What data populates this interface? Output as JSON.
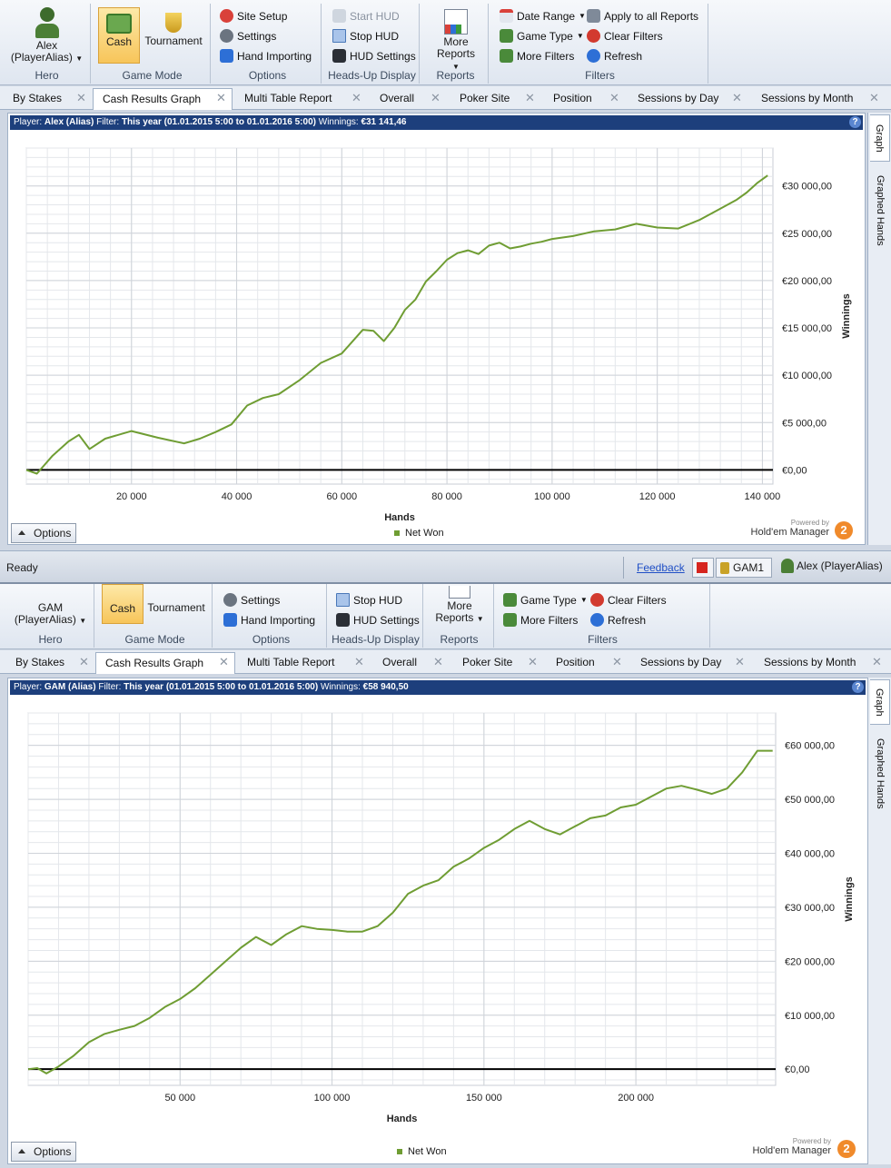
{
  "colors": {
    "series": "#6f9d33",
    "header_bg": "#1d3f7c",
    "active_button": "#f7c55a"
  },
  "panels": [
    {
      "ribbon": {
        "hero": {
          "name": "Alex",
          "alias": "(PlayerAlias)",
          "title": "Hero"
        },
        "game_mode": {
          "cash": "Cash",
          "tournament": "Tournament",
          "title": "Game Mode"
        },
        "options": {
          "site_setup": "Site Setup",
          "settings": "Settings",
          "hand_importing": "Hand Importing",
          "title": "Options"
        },
        "hud": {
          "start": "Start HUD",
          "stop": "Stop HUD",
          "settings": "HUD Settings",
          "title": "Heads-Up Display"
        },
        "reports": {
          "more1": "More",
          "more2": "Reports",
          "title": "Reports"
        },
        "filters": {
          "date_range": "Date Range",
          "apply_all": "Apply to all Reports",
          "game_type": "Game Type",
          "clear": "Clear Filters",
          "more": "More Filters",
          "refresh": "Refresh",
          "title": "Filters"
        }
      },
      "tabs": [
        "By Stakes",
        "Cash Results Graph",
        "Multi Table Report",
        "Overall",
        "Poker Site",
        "Position",
        "Sessions by Day",
        "Sessions by Month"
      ],
      "header": {
        "player_label": "Player:",
        "player": "Alex (Alias)",
        "filter_label": "Filter:",
        "filter": "This year (01.01.2015 5:00 to 01.01.2016 5:00)",
        "winnings_label": "Winnings:",
        "winnings": "€31 141,46",
        "help": "?"
      },
      "side_tabs": [
        "Graph",
        "Graphed Hands"
      ],
      "options_label": "Options",
      "powered_by": "Powered by",
      "brand": "Hold'em Manager",
      "brand_logo": "2",
      "status": {
        "ready": "Ready",
        "feedback": "Feedback",
        "site": "GAM1",
        "user": "Alex (PlayerAlias)"
      }
    },
    {
      "ribbon": {
        "hero": {
          "name": "GAM",
          "alias": "(PlayerAlias)",
          "title": "Hero"
        },
        "game_mode": {
          "cash": "Cash",
          "tournament": "Tournament",
          "title": "Game Mode"
        },
        "options": {
          "settings": "Settings",
          "hand_importing": "Hand Importing",
          "title": "Options"
        },
        "hud": {
          "stop": "Stop HUD",
          "settings": "HUD Settings",
          "title": "Heads-Up Display"
        },
        "reports": {
          "more1": "More",
          "more2": "Reports",
          "title": "Reports"
        },
        "filters": {
          "game_type": "Game Type",
          "clear": "Clear Filters",
          "more": "More Filters",
          "refresh": "Refresh",
          "title": "Filters"
        }
      },
      "tabs": [
        "By Stakes",
        "Cash Results Graph",
        "Multi Table Report",
        "Overall",
        "Poker Site",
        "Position",
        "Sessions by Day",
        "Sessions by Month"
      ],
      "header": {
        "player_label": "Player:",
        "player": "GAM (Alias)",
        "filter_label": "Filter:",
        "filter": "This year (01.01.2015 5:00 to 01.01.2016 5:00)",
        "winnings_label": "Winnings:",
        "winnings": "€58 940,50",
        "help": "?"
      },
      "side_tabs": [
        "Graph",
        "Graphed Hands"
      ],
      "options_label": "Options",
      "powered_by": "Powered by",
      "brand": "Hold'em Manager",
      "brand_logo": "2"
    }
  ],
  "chart_data": [
    {
      "type": "line",
      "title": "",
      "xlabel": "Hands",
      "ylabel": "Winnings",
      "xlim": [
        0,
        142000
      ],
      "ylim": [
        -1500,
        34000
      ],
      "x_ticks": [
        20000,
        40000,
        60000,
        80000,
        100000,
        120000,
        140000
      ],
      "x_tick_labels": [
        "20 000",
        "40 000",
        "60 000",
        "80 000",
        "100 000",
        "120 000",
        "140 000"
      ],
      "y_ticks": [
        0,
        5000,
        10000,
        15000,
        20000,
        25000,
        30000
      ],
      "y_tick_labels": [
        "€0,00",
        "€5 000,00",
        "€10 000,00",
        "€15 000,00",
        "€20 000,00",
        "€25 000,00",
        "€30 000,00"
      ],
      "grid": true,
      "legend": "bottom-center",
      "series": [
        {
          "name": "Net Won",
          "x": [
            0,
            2000,
            5000,
            8000,
            10000,
            12000,
            15000,
            20000,
            25000,
            30000,
            33000,
            36000,
            39000,
            42000,
            45000,
            48000,
            52000,
            56000,
            60000,
            64000,
            66000,
            68000,
            70000,
            72000,
            74000,
            76000,
            78000,
            80000,
            82000,
            84000,
            86000,
            88000,
            90000,
            92000,
            94000,
            96000,
            98000,
            100000,
            104000,
            108000,
            112000,
            116000,
            120000,
            124000,
            128000,
            132000,
            135000,
            137000,
            139000,
            141000
          ],
          "values": [
            0,
            -400,
            1500,
            3000,
            3700,
            2200,
            3300,
            4100,
            3400,
            2800,
            3300,
            4000,
            4800,
            6800,
            7600,
            8000,
            9500,
            11300,
            12300,
            14800,
            14700,
            13600,
            15000,
            16900,
            18000,
            19900,
            21000,
            22200,
            22900,
            23200,
            22800,
            23700,
            24000,
            23400,
            23600,
            23900,
            24100,
            24400,
            24700,
            25200,
            25400,
            26000,
            25600,
            25500,
            26400,
            27600,
            28500,
            29300,
            30300,
            31100
          ]
        }
      ]
    },
    {
      "type": "line",
      "title": "",
      "xlabel": "Hands",
      "ylabel": "Winnings",
      "xlim": [
        0,
        246000
      ],
      "ylim": [
        -3000,
        66000
      ],
      "x_ticks": [
        50000,
        100000,
        150000,
        200000
      ],
      "x_tick_labels": [
        "50 000",
        "100 000",
        "150 000",
        "200 000"
      ],
      "y_ticks": [
        0,
        10000,
        20000,
        30000,
        40000,
        50000,
        60000
      ],
      "y_tick_labels": [
        "€0,00",
        "€10 000,00",
        "€20 000,00",
        "€30 000,00",
        "€40 000,00",
        "€50 000,00",
        "€60 000,00"
      ],
      "grid": true,
      "legend": "bottom-center",
      "series": [
        {
          "name": "Net Won",
          "x": [
            0,
            3000,
            6000,
            10000,
            15000,
            20000,
            25000,
            30000,
            35000,
            40000,
            45000,
            50000,
            55000,
            60000,
            65000,
            70000,
            75000,
            80000,
            85000,
            90000,
            95000,
            100000,
            105000,
            110000,
            115000,
            120000,
            125000,
            130000,
            135000,
            140000,
            145000,
            150000,
            155000,
            160000,
            165000,
            170000,
            175000,
            180000,
            185000,
            190000,
            195000,
            200000,
            205000,
            210000,
            215000,
            220000,
            225000,
            230000,
            235000,
            240000,
            245000
          ],
          "values": [
            0,
            200,
            -800,
            500,
            2500,
            5000,
            6500,
            7300,
            8000,
            9500,
            11500,
            13000,
            15000,
            17500,
            20000,
            22500,
            24500,
            23000,
            25000,
            26500,
            26000,
            25800,
            25500,
            25500,
            26500,
            29000,
            32500,
            34000,
            35000,
            37500,
            39000,
            41000,
            42500,
            44500,
            46000,
            44500,
            43500,
            45000,
            46500,
            47000,
            48500,
            49000,
            50500,
            52000,
            52500,
            51800,
            51000,
            52000,
            55000,
            59000,
            59000
          ]
        }
      ]
    }
  ]
}
